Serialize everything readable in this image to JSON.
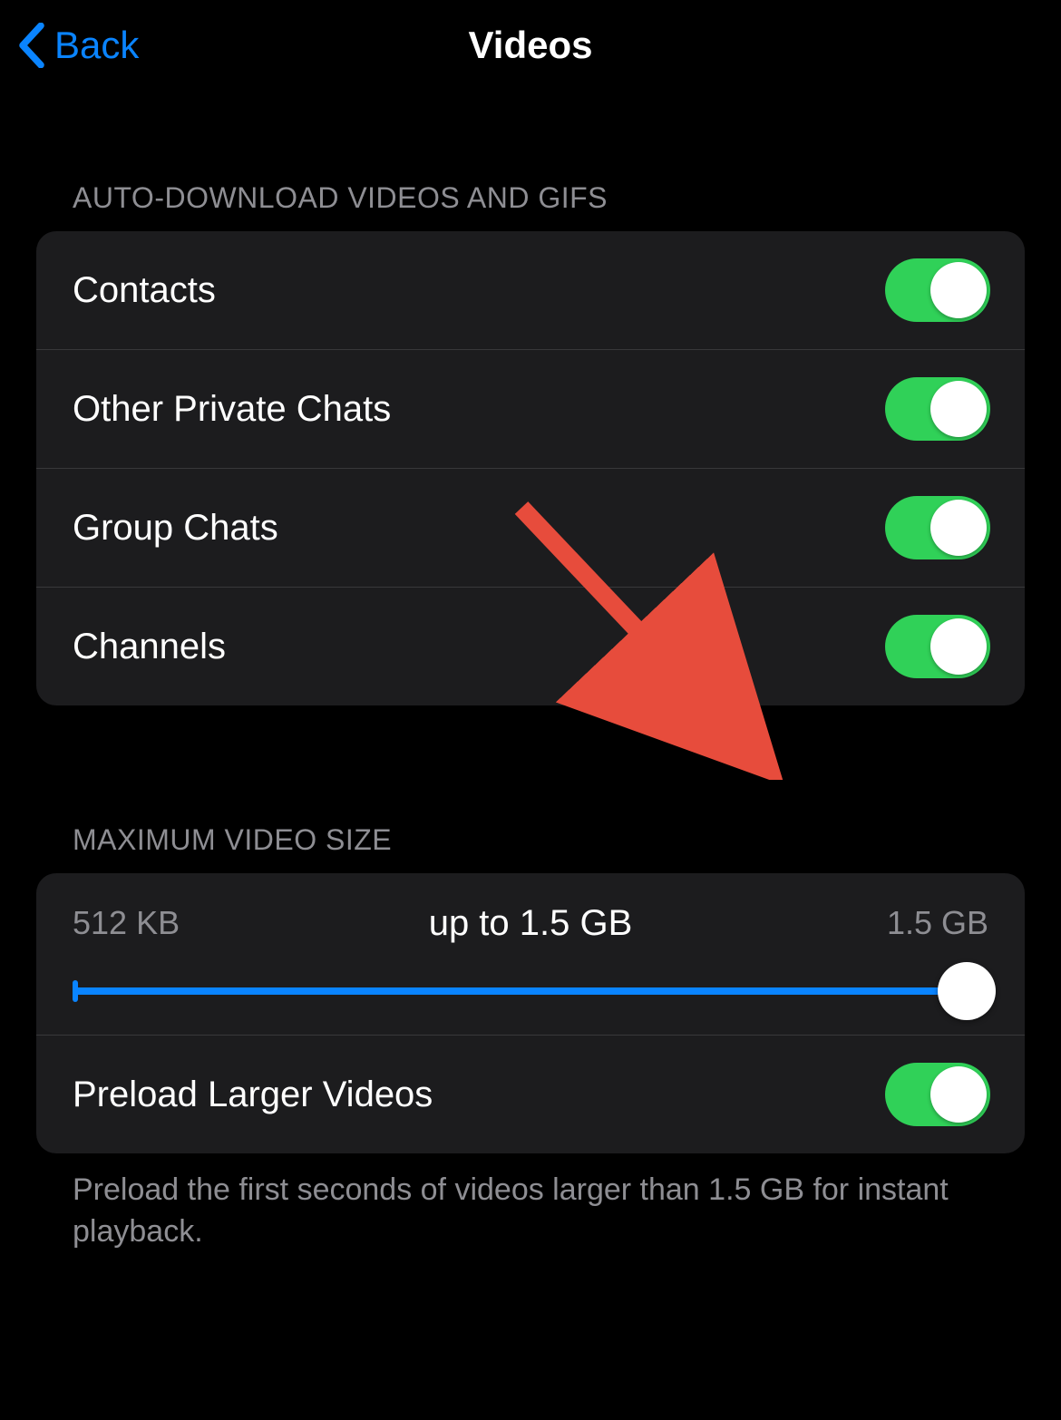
{
  "nav": {
    "back_label": "Back",
    "title": "Videos"
  },
  "autodownload": {
    "header": "AUTO-DOWNLOAD VIDEOS AND GIFS",
    "rows": [
      {
        "label": "Contacts",
        "on": true
      },
      {
        "label": "Other Private Chats",
        "on": true
      },
      {
        "label": "Group Chats",
        "on": true
      },
      {
        "label": "Channels",
        "on": true
      }
    ]
  },
  "maxsize": {
    "header": "MAXIMUM VIDEO SIZE",
    "min_label": "512 KB",
    "current_label": "up to 1.5 GB",
    "max_label": "1.5 GB",
    "preload_label": "Preload Larger Videos",
    "preload_on": true,
    "footer": "Preload the first seconds of videos larger than 1.5 GB for instant playback."
  }
}
